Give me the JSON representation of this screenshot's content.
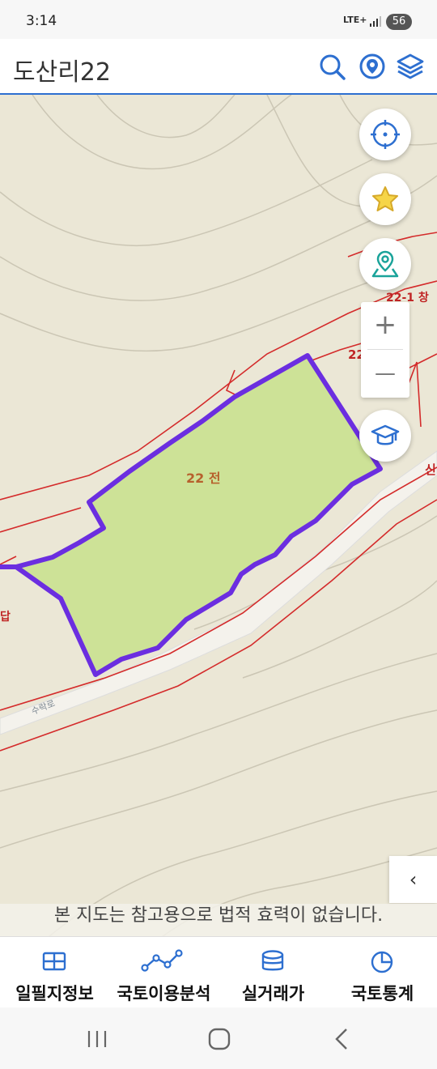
{
  "status_bar": {
    "time": "3:14",
    "network": "LTE+",
    "battery": "56"
  },
  "header": {
    "title": "도산리22"
  },
  "map": {
    "parcel_label": "22 전",
    "parcel_labels": [
      "22-1 창",
      "22",
      "신",
      "답"
    ],
    "road_label": "수락로",
    "parcel_fill": "#cde297",
    "parcel_border": "#6b2ee0",
    "boundary_color": "#d42b2b"
  },
  "zoom": {
    "in_label": "+",
    "out_label": "—"
  },
  "collapse_label": "‹",
  "disclaimer": "본 지도는 참고용으로 법적 효력이 없습니다.",
  "bottom_nav": {
    "items": [
      {
        "label": "일필지정보",
        "icon": "grid-map-icon"
      },
      {
        "label": "국토이용분석",
        "icon": "line-graph-icon"
      },
      {
        "label": "실거래가",
        "icon": "database-icon"
      },
      {
        "label": "국토통계",
        "icon": "pie-chart-icon"
      }
    ]
  },
  "colors": {
    "accent": "#2d6fd0"
  }
}
